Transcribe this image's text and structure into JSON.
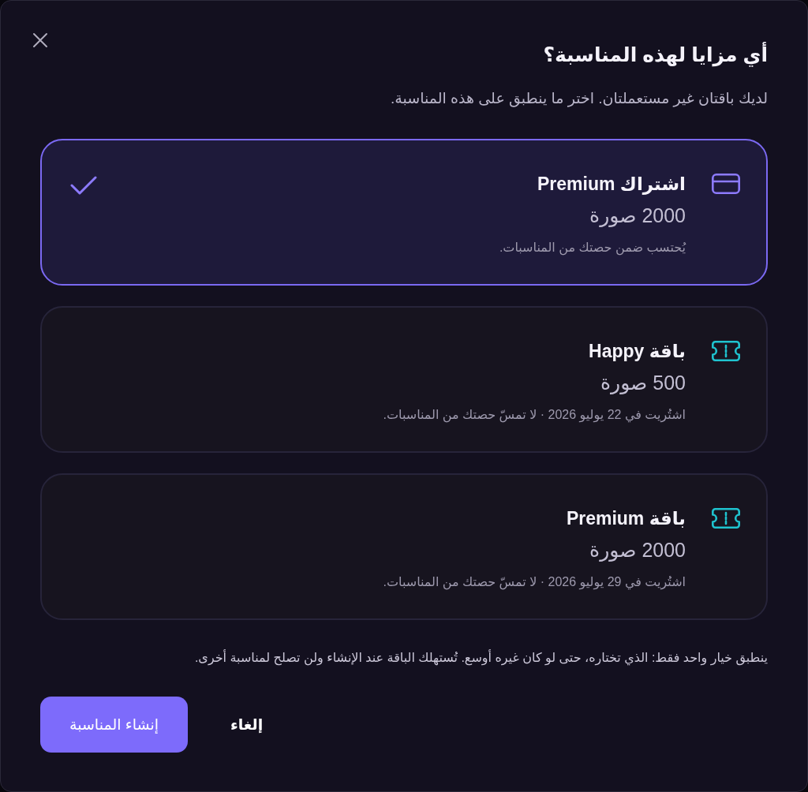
{
  "dialog": {
    "title": "أي مزايا لهذه المناسبة؟",
    "subtitle": "لديك باقتان غير مستعملتان. اختر ما ينطبق على هذه المناسبة."
  },
  "options": [
    {
      "kind": "subscription",
      "title": "اشتراك Premium",
      "count": "2000 صورة",
      "note": "يُحتسب ضمن حصتك من المناسبات.",
      "selected": true
    },
    {
      "kind": "pack",
      "title": "باقة Happy",
      "count": "500 صورة",
      "note": "اشتُريت في 22 يوليو 2026 · لا تمسّ حصتك من المناسبات.",
      "selected": false
    },
    {
      "kind": "pack",
      "title": "باقة Premium",
      "count": "2000 صورة",
      "note": "اشتُريت في 29 يوليو 2026 · لا تمسّ حصتك من المناسبات.",
      "selected": false
    }
  ],
  "footer_note": "ينطبق خيار واحد فقط: الذي تختاره، حتى لو كان غيره أوسع. تُستهلك الباقة عند الإنشاء ولن تصلح لمناسبة أخرى.",
  "buttons": [
    {
      "kind": "secondary",
      "label": "إلغاء"
    },
    {
      "kind": "primary",
      "label": "إنشاء المناسبة"
    }
  ]
}
